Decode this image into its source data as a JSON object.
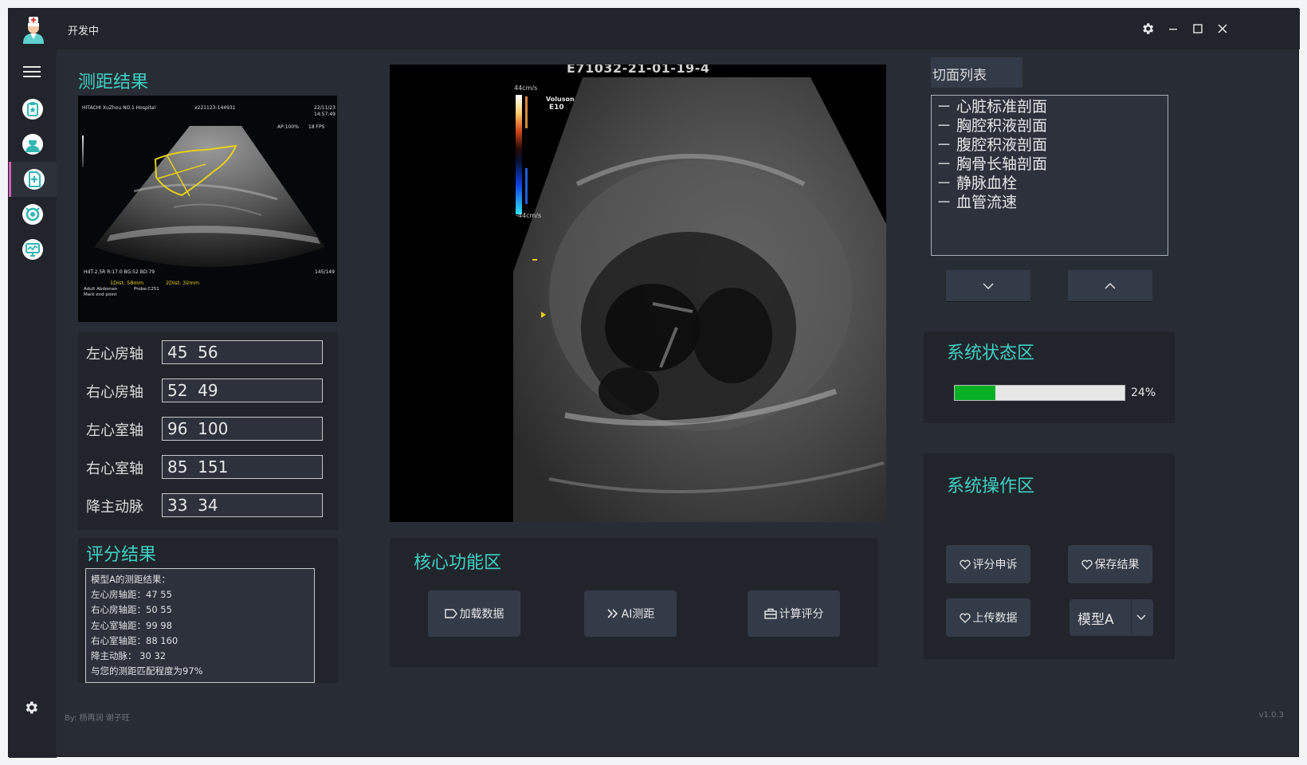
{
  "app": {
    "title": "开发中",
    "author": "By: 杨再润 谢子旺",
    "version": "v1.0.3"
  },
  "sidebar": {
    "items": [
      {
        "name": "clipboard-star-icon"
      },
      {
        "name": "doctor-icon"
      },
      {
        "name": "document-plus-icon"
      },
      {
        "name": "stethoscope-icon"
      },
      {
        "name": "monitor-chart-icon"
      }
    ]
  },
  "measurement": {
    "title": "测距结果",
    "thumbnail": {
      "hospital": "HITACHI XuZhou NO.1 Hospital",
      "id": "x221123-144931",
      "date": "22/11/23",
      "time": "14:57:49",
      "ap": "AP:100%",
      "fps": "18 FPS",
      "params": "HdT-2.5R  R:17.0 BG:52  BD:79",
      "mode": "Adult Abdomen",
      "probe": "Probe:C251",
      "mark": "Mark end point",
      "dist1": "1Dist:  58mm",
      "dist2": "2Dist:  32mm",
      "frames": "145/149"
    },
    "fields": [
      {
        "label": "左心房轴",
        "value": "45  56"
      },
      {
        "label": "右心房轴",
        "value": "52  49"
      },
      {
        "label": "左心室轴",
        "value": "96  100"
      },
      {
        "label": "右心室轴",
        "value": "85  151"
      },
      {
        "label": "降主动脉",
        "value": "33  34"
      }
    ]
  },
  "score": {
    "title": "评分结果",
    "lines": [
      "模型A的测距结果：",
      "左心房轴距：47 55",
      "右心房轴距：50 55",
      "左心室轴距：99 98",
      "右心室轴距：88 160",
      "降主动脉：  30 32",
      "与您的测距匹配程度为97%"
    ]
  },
  "main_image": {
    "caption": "E71032-21-01-19-4",
    "scale_top": "44cm/s",
    "scale_bottom": "-44cm/s",
    "brand": "Voluson",
    "model": "E10"
  },
  "core": {
    "title": "核心功能区",
    "buttons": [
      {
        "label": "加载数据",
        "icon": "tag-icon"
      },
      {
        "label": "AI测距",
        "icon": "double-chevron-icon"
      },
      {
        "label": "计算评分",
        "icon": "briefcase-icon"
      }
    ]
  },
  "section_list": {
    "title": "切面列表",
    "items": [
      "心脏标准剖面",
      "胸腔积液剖面",
      "腹腔积液剖面",
      "胸骨长轴剖面",
      "静脉血栓",
      "血管流速"
    ]
  },
  "status": {
    "title": "系统状态区",
    "progress": 24,
    "progress_label": "24%"
  },
  "operations": {
    "title": "系统操作区",
    "buttons": [
      "评分申诉",
      "保存结果",
      "上传数据"
    ],
    "model_select": "模型A"
  },
  "colors": {
    "accent": "#3fd1c3",
    "progress": "#06b025",
    "active_nav": "#d35fb7",
    "background": "#282c34",
    "panel": "#21252b"
  }
}
